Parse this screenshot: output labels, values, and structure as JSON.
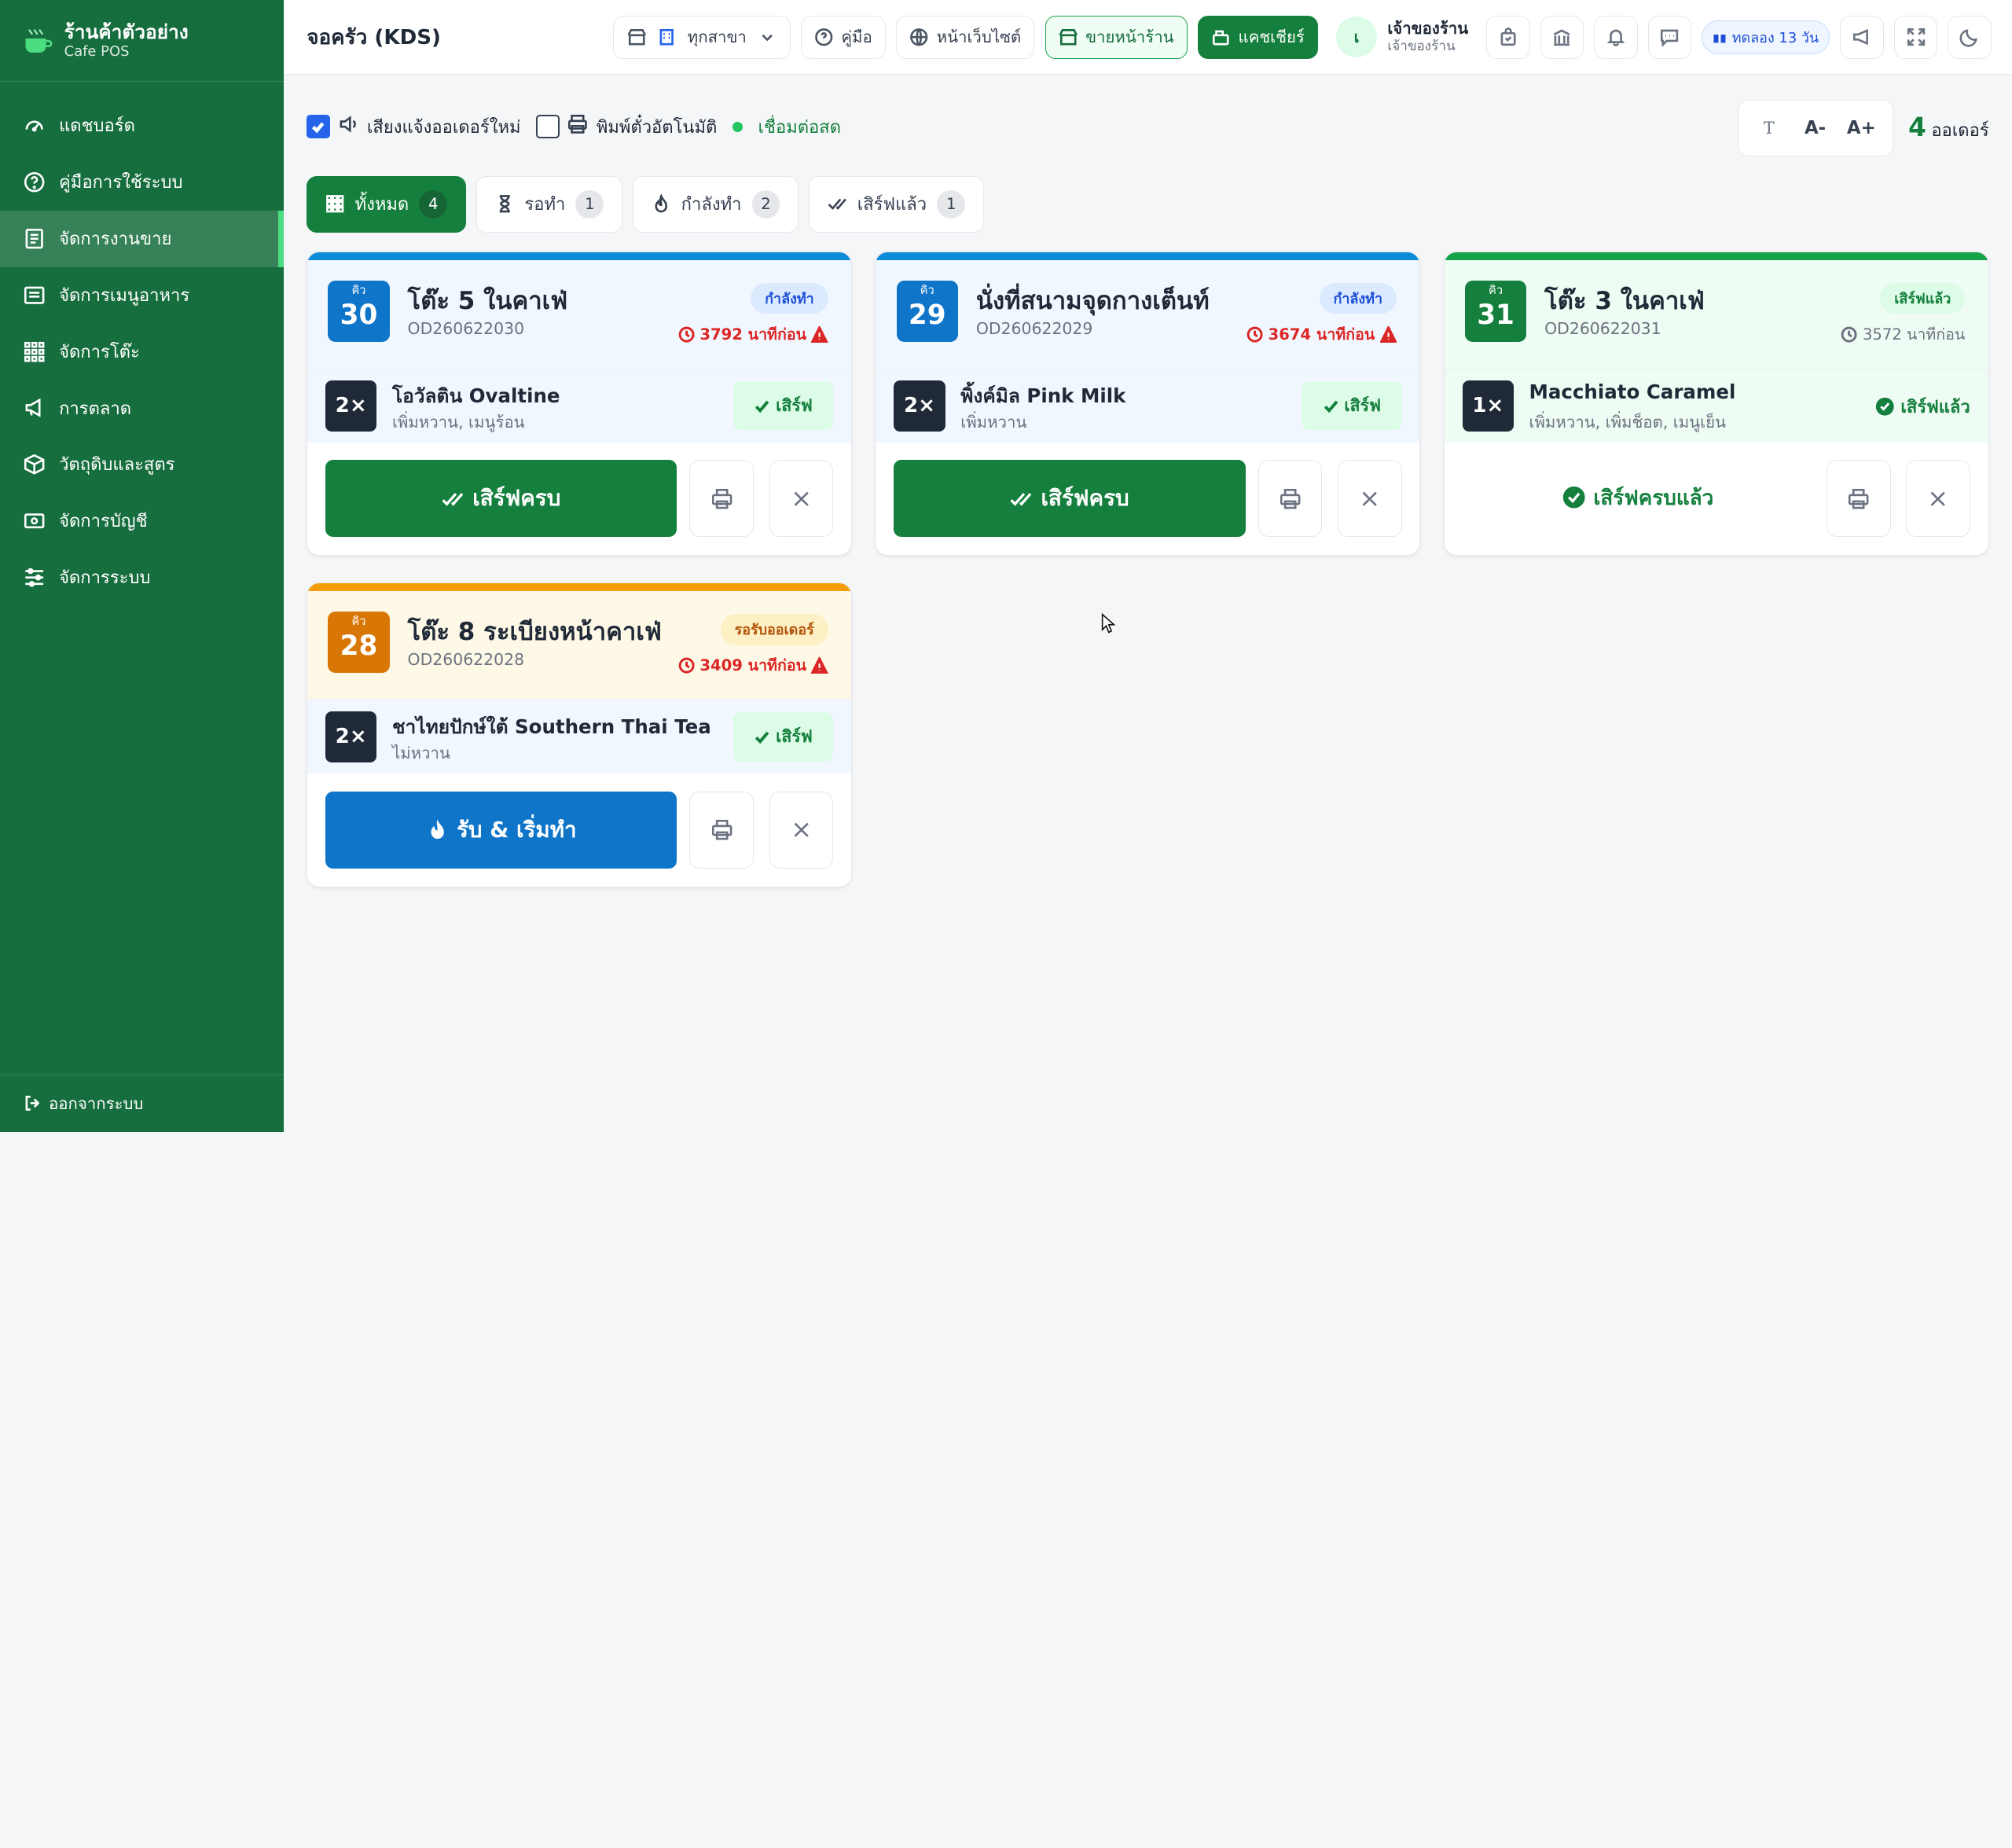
{
  "brand": {
    "title": "ร้านค้าตัวอย่าง",
    "subtitle": "Cafe POS"
  },
  "sidebar": {
    "items": [
      {
        "label": "แดชบอร์ด",
        "icon": "dashboard-icon"
      },
      {
        "label": "คู่มือการใช้ระบบ",
        "icon": "help-circle-icon"
      },
      {
        "label": "จัดการงานขาย",
        "icon": "receipt-icon",
        "active": true
      },
      {
        "label": "จัดการเมนูอาหาร",
        "icon": "menu-list-icon"
      },
      {
        "label": "จัดการโต๊ะ",
        "icon": "grid-icon"
      },
      {
        "label": "การตลาด",
        "icon": "megaphone-icon"
      },
      {
        "label": "วัตถุดิบและสูตร",
        "icon": "box-icon"
      },
      {
        "label": "จัดการบัญชี",
        "icon": "money-icon"
      },
      {
        "label": "จัดการระบบ",
        "icon": "sliders-icon"
      }
    ],
    "logout": "ออกจากระบบ"
  },
  "topbar": {
    "title": "จอครัว (KDS)",
    "branch": "ทุกสาขา",
    "manual": "คู่มือ",
    "website": "หน้าเว็บไซต์",
    "storefront": "ขายหน้าร้าน",
    "cashier": "แคชเชียร์",
    "user": {
      "initial": "เ",
      "name": "เจ้าของร้าน",
      "role": "เจ้าของร้าน"
    },
    "trial": "ทดลอง 13 วัน"
  },
  "controls": {
    "sound_label": "เสียงแจ้งออเดอร์ใหม่",
    "sound_checked": true,
    "autoprint_label": "พิมพ์ตั๋วอัตโนมัติ",
    "autoprint_checked": false,
    "live_label": "เชื่อมต่อสด",
    "font_t": "T",
    "font_dec": "A-",
    "font_inc": "A+",
    "order_count": "4",
    "order_label": "ออเดอร์"
  },
  "tabs": [
    {
      "label": "ทั้งหมด",
      "count": "4",
      "icon": "grid-icon",
      "active": true
    },
    {
      "label": "รอทำ",
      "count": "1",
      "icon": "hourglass-icon"
    },
    {
      "label": "กำลังทำ",
      "count": "2",
      "icon": "flame-icon"
    },
    {
      "label": "เสิร์ฟแล้ว",
      "count": "1",
      "icon": "double-check-icon"
    }
  ],
  "orders": [
    {
      "queue_label": "คิว",
      "queue": "30",
      "title": "โต๊ะ 5 ในคาเฟ่",
      "code": "OD260622030",
      "status": "กำลังทำ",
      "elapsed": "3792 นาทีก่อน",
      "item": {
        "qty": "2×",
        "name": "โอวัลติน Ovaltine",
        "options": "เพิ่มหวาน, เมนูร้อน",
        "serve": "เสิร์ฟ"
      },
      "action": "เสิร์ฟครบ"
    },
    {
      "queue_label": "คิว",
      "queue": "29",
      "title": "นั่งที่สนามจุดกางเต็นท์",
      "code": "OD260622029",
      "status": "กำลังทำ",
      "elapsed": "3674 นาทีก่อน",
      "item": {
        "qty": "2×",
        "name": "พิ้งค์มิล Pink Milk",
        "options": "เพิ่มหวาน",
        "serve": "เสิร์ฟ"
      },
      "action": "เสิร์ฟครบ"
    },
    {
      "queue_label": "คิว",
      "queue": "31",
      "title": "โต๊ะ 3 ในคาเฟ่",
      "code": "OD260622031",
      "status": "เสิร์ฟแล้ว",
      "elapsed": "3572 นาทีก่อน",
      "item": {
        "qty": "1×",
        "name": "Macchiato Caramel",
        "options": "เพิ่มหวาน, เพิ่มช็อต, เมนูเย็น",
        "served": "เสิร์ฟแล้ว"
      },
      "action": "เสิร์ฟครบแล้ว"
    },
    {
      "queue_label": "คิว",
      "queue": "28",
      "title": "โต๊ะ 8 ระเบียงหน้าคาเฟ่",
      "code": "OD260622028",
      "status": "รอรับออเดอร์",
      "elapsed": "3409 นาทีก่อน",
      "item": {
        "qty": "2×",
        "name": "ชาไทยปักษ์ใต้ Southern Thai Tea",
        "options": "ไม่หวาน",
        "serve": "เสิร์ฟ"
      },
      "action": "รับ & เริ่มทำ"
    }
  ],
  "colors": {
    "sidebar": "#166d3d",
    "cooking": "#0e8bd8",
    "served": "#16a34a",
    "pending": "#f59e0b",
    "late": "#dc2626"
  }
}
